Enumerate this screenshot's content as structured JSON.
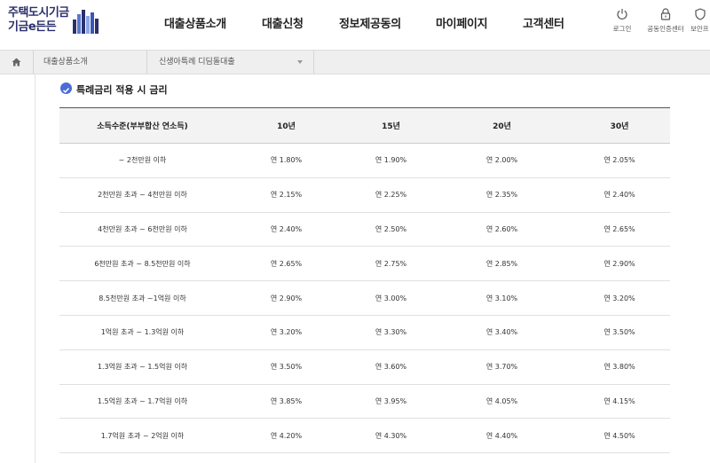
{
  "header": {
    "logo_line1": "주택도시기금",
    "logo_line2": "기금e든든",
    "nav": [
      "대출상품소개",
      "대출신청",
      "정보제공동의",
      "마이페이지",
      "고객센터"
    ],
    "util": [
      {
        "label": "로그인",
        "icon": "power-icon"
      },
      {
        "label": "공동인증센터",
        "icon": "lock-icon"
      },
      {
        "label": "보안프",
        "icon": "shield-icon"
      }
    ]
  },
  "breadcrumb": {
    "level1": "대출상품소개",
    "level2": "신생아특례 디딤돌대출"
  },
  "section": {
    "title": "특례금리 적용 시 금리"
  },
  "rate_table": {
    "headers": [
      "소득수준(부부합산 연소득)",
      "10년",
      "15년",
      "20년",
      "30년"
    ],
    "rows": [
      [
        "~ 2천만원 이하",
        "연 1.80%",
        "연 1.90%",
        "연 2.00%",
        "연 2.05%"
      ],
      [
        "2천만원 초과 ~ 4천만원 이하",
        "연 2.15%",
        "연 2.25%",
        "연 2.35%",
        "연 2.40%"
      ],
      [
        "4천만원 초과 ~ 6천만원 이하",
        "연 2.40%",
        "연 2.50%",
        "연 2.60%",
        "연 2.65%"
      ],
      [
        "6천만원 초과 ~ 8.5천만원 이하",
        "연 2.65%",
        "연 2.75%",
        "연 2.85%",
        "연 2.90%"
      ],
      [
        "8.5천만원 초과 ~1억원 이하",
        "연 2.90%",
        "연 3.00%",
        "연 3.10%",
        "연 3.20%"
      ],
      [
        "1억원 초과 ~ 1.3억원 이하",
        "연 3.20%",
        "연 3.30%",
        "연 3.40%",
        "연 3.50%"
      ],
      [
        "1.3억원 초과 ~ 1.5억원 이하",
        "연 3.50%",
        "연 3.60%",
        "연 3.70%",
        "연 3.80%"
      ],
      [
        "1.5억원 초과 ~ 1.7억원 이하",
        "연 3.85%",
        "연 3.95%",
        "연 4.05%",
        "연 4.15%"
      ],
      [
        "1.7억원 초과 ~ 2억원 이하",
        "연 4.20%",
        "연 4.30%",
        "연 4.40%",
        "연 4.50%"
      ]
    ]
  },
  "colors": {
    "brand_navy": "#2b2f6b",
    "check_blue": "#4a6cd8"
  }
}
